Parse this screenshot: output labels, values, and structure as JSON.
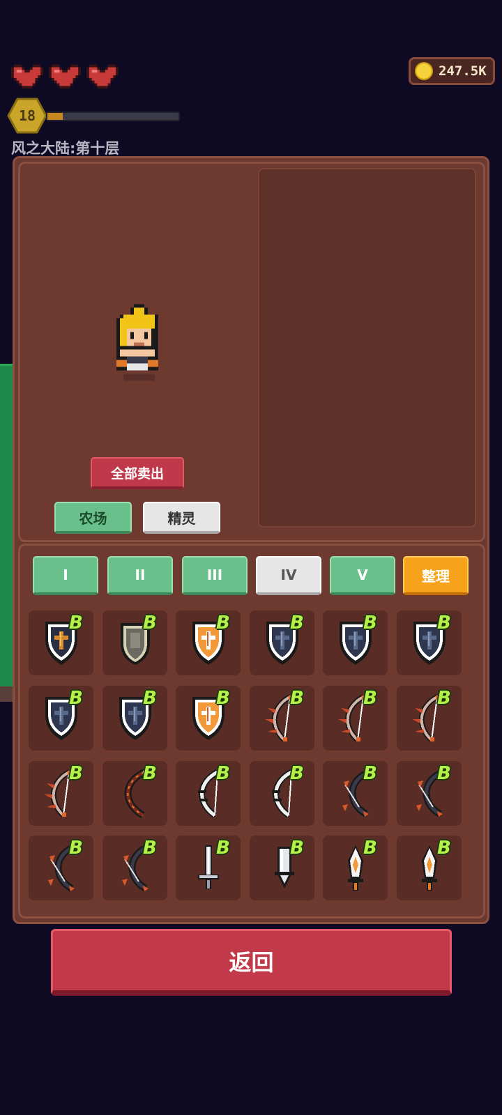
{
  "hud": {
    "hearts": 3,
    "coins": "247.5K",
    "level": "18",
    "xp_progress": 0.12,
    "location": "风之大陆:第十层"
  },
  "upper": {
    "sell_all_label": "全部卖出",
    "farm_label": "农场",
    "elf_label": "精灵"
  },
  "tabs": [
    {
      "label": "I",
      "state": "green"
    },
    {
      "label": "II",
      "state": "green"
    },
    {
      "label": "III",
      "state": "green"
    },
    {
      "label": "IV",
      "state": "selected"
    },
    {
      "label": "V",
      "state": "green"
    },
    {
      "label": "整理",
      "state": "orange"
    }
  ],
  "inventory": [
    {
      "item": "dark-shield-icon",
      "grade": "B"
    },
    {
      "item": "stone-shield-icon",
      "grade": "B"
    },
    {
      "item": "orange-shield-icon",
      "grade": "B"
    },
    {
      "item": "blue-shield-icon",
      "grade": "B"
    },
    {
      "item": "blue-shield-icon",
      "grade": "B"
    },
    {
      "item": "blue-shield-icon",
      "grade": "B"
    },
    {
      "item": "blue-shield-icon",
      "grade": "B"
    },
    {
      "item": "blue-shield-icon",
      "grade": "B"
    },
    {
      "item": "orange-shield-icon",
      "grade": "B"
    },
    {
      "item": "spiked-bow-icon",
      "grade": "B"
    },
    {
      "item": "spiked-bow-icon",
      "grade": "B"
    },
    {
      "item": "spiked-bow-icon",
      "grade": "B"
    },
    {
      "item": "spiked-bow-icon",
      "grade": "B"
    },
    {
      "item": "red-bow-icon",
      "grade": "B"
    },
    {
      "item": "white-bow-icon",
      "grade": "B"
    },
    {
      "item": "white-bow-icon",
      "grade": "B"
    },
    {
      "item": "dark-bow-icon",
      "grade": "B"
    },
    {
      "item": "dark-bow-icon",
      "grade": "B"
    },
    {
      "item": "dark-bow-icon",
      "grade": "B"
    },
    {
      "item": "dark-bow-icon",
      "grade": "B"
    },
    {
      "item": "sword-icon",
      "grade": "B"
    },
    {
      "item": "broadsword-icon",
      "grade": "B"
    },
    {
      "item": "flame-dagger-icon",
      "grade": "B"
    },
    {
      "item": "flame-dagger-icon",
      "grade": "B"
    }
  ],
  "colors": {
    "background": "#0f0a24",
    "panel": "#6a3a30",
    "green_button": "#6ac08a",
    "red_button": "#c23a4a",
    "orange_button": "#f6a21a",
    "badge": "#b6f04a"
  },
  "back_label": "返回"
}
